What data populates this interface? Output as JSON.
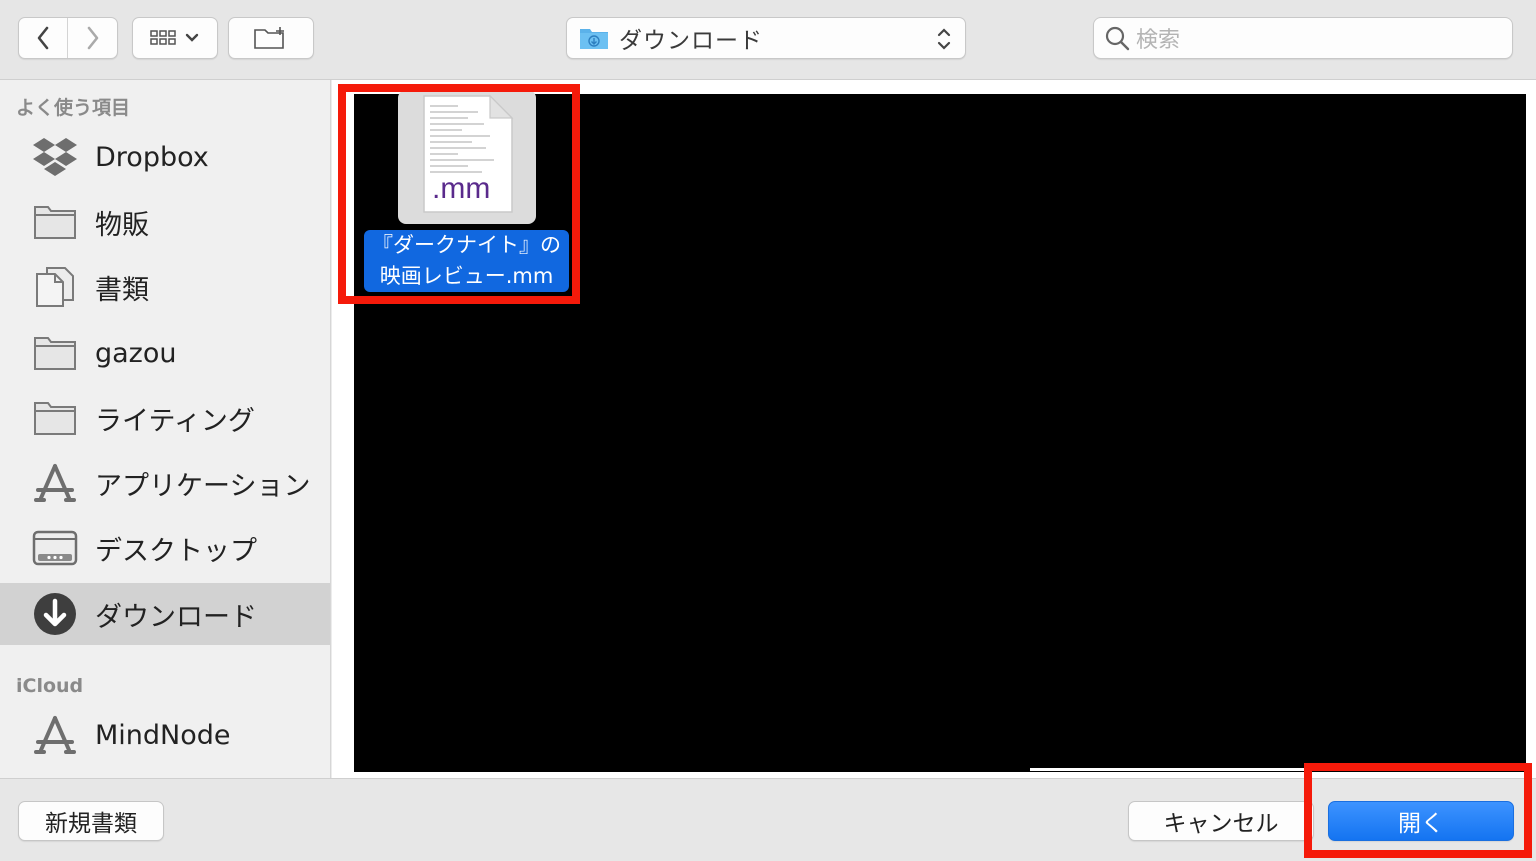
{
  "toolbar": {
    "location": "ダウンロード",
    "search_placeholder": "検索"
  },
  "sidebar": {
    "favorites_heading": "よく使う項目",
    "favorites": [
      {
        "label": "Dropbox",
        "icon": "dropbox-icon"
      },
      {
        "label": "物販",
        "icon": "folder-icon"
      },
      {
        "label": "書類",
        "icon": "documents-icon"
      },
      {
        "label": "gazou",
        "icon": "folder-icon"
      },
      {
        "label": "ライティング",
        "icon": "folder-icon"
      },
      {
        "label": "アプリケーション",
        "icon": "applications-icon"
      },
      {
        "label": "デスクトップ",
        "icon": "desktop-icon"
      },
      {
        "label": "ダウンロード",
        "icon": "downloads-icon",
        "selected": true
      }
    ],
    "icloud_heading": "iCloud",
    "icloud": [
      {
        "label": "MindNode",
        "icon": "applications-icon"
      }
    ]
  },
  "file": {
    "extension": ".mm",
    "name_line1": "『ダークナイト』の",
    "name_line2": "映画レビュー.mm"
  },
  "buttons": {
    "new_document": "新規書類",
    "cancel": "キャンセル",
    "open": "開く"
  },
  "colors": {
    "highlight_red": "#f51a0a",
    "selection_blue": "#1168e0",
    "open_button_blue": "#1474f1"
  }
}
